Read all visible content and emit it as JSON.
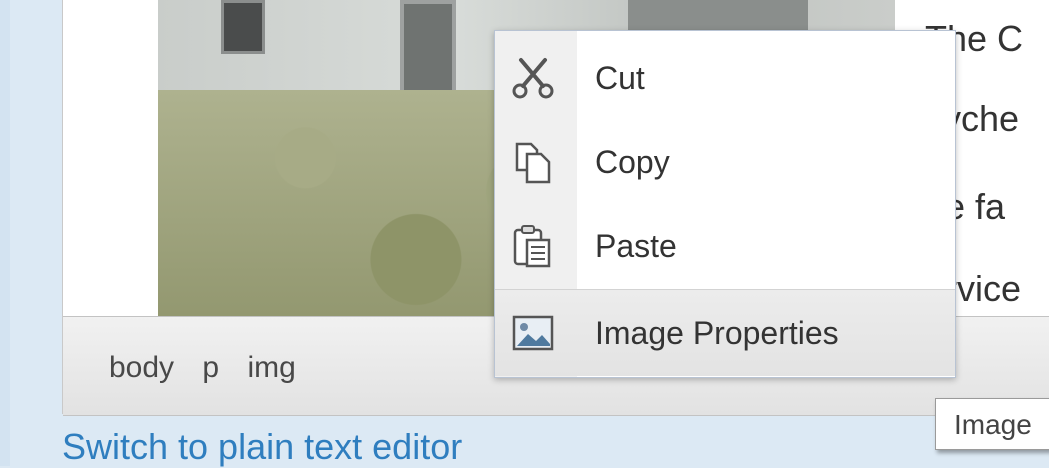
{
  "editor": {
    "body_text": [
      "The C",
      "syche",
      "he fa",
      "ervice"
    ]
  },
  "status_bar": {
    "path": [
      "body",
      "p",
      "img"
    ]
  },
  "context_menu": {
    "items": [
      {
        "label": "Cut",
        "icon": "scissors-icon"
      },
      {
        "label": "Copy",
        "icon": "copy-icon"
      },
      {
        "label": "Paste",
        "icon": "paste-icon"
      },
      {
        "label": "Image Properties",
        "icon": "image-icon"
      }
    ]
  },
  "switch_link": "Switch to plain text editor",
  "tooltip": "Image"
}
